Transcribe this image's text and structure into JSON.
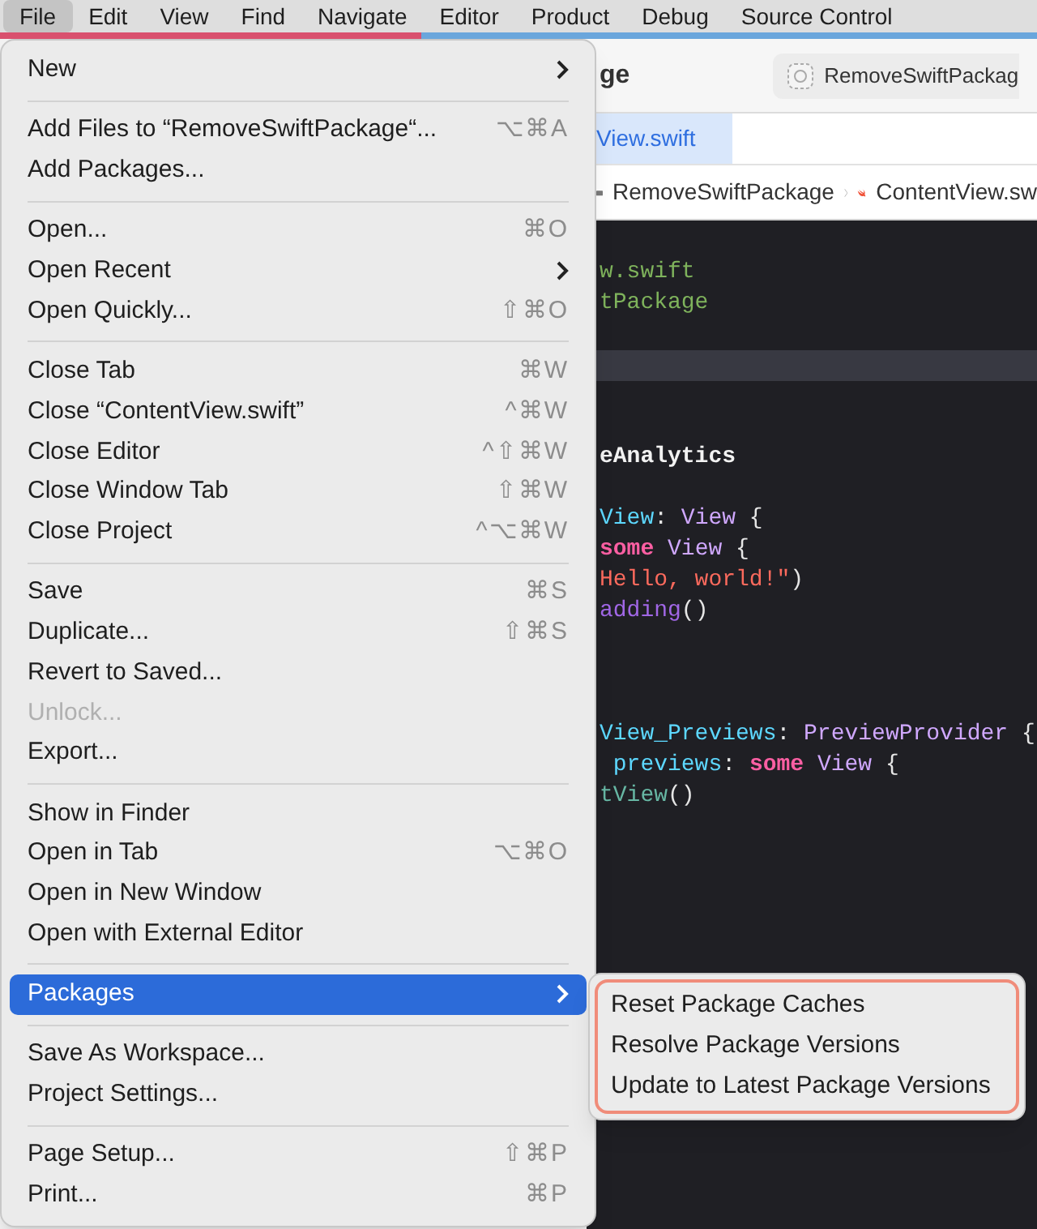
{
  "menu_bar": [
    {
      "label": "File",
      "selected": true
    },
    {
      "label": "Edit",
      "selected": false
    },
    {
      "label": "View",
      "selected": false
    },
    {
      "label": "Find",
      "selected": false
    },
    {
      "label": "Navigate",
      "selected": false
    },
    {
      "label": "Editor",
      "selected": false
    },
    {
      "label": "Product",
      "selected": false
    },
    {
      "label": "Debug",
      "selected": false
    },
    {
      "label": "Source Control",
      "selected": false
    }
  ],
  "toolbar": {
    "title": "ge",
    "scheme": "RemoveSwiftPackag"
  },
  "tabs": [
    {
      "label": "View.swift",
      "selected": true
    }
  ],
  "jump_bar": [
    "RemoveSwiftPackage",
    "ContentView.sw"
  ],
  "code_lines": [
    {
      "current": false
    },
    {
      "current": false,
      "tokens": [
        {
          "text": "w.swift",
          "kind": "comment"
        }
      ]
    },
    {
      "current": false,
      "tokens": [
        {
          "text": "tPackage",
          "kind": "comment"
        }
      ]
    },
    {
      "current": false
    },
    {
      "current": true
    },
    {
      "current": false
    },
    {
      "current": false
    },
    {
      "current": false,
      "tokens": [
        {
          "text": "eAnalytics",
          "kind": "module"
        }
      ]
    },
    {
      "current": false
    },
    {
      "current": false,
      "tokens": [
        {
          "text": "View",
          "kind": "decl"
        },
        {
          "text": ": ",
          "kind": "plain"
        },
        {
          "text": "View",
          "kind": "type"
        },
        {
          "text": " {",
          "kind": "plain"
        }
      ]
    },
    {
      "current": false,
      "tokens": [
        {
          "text": "some",
          "kind": "keyword"
        },
        {
          "text": " View",
          "kind": "type"
        },
        {
          "text": " {",
          "kind": "plain"
        }
      ]
    },
    {
      "current": false,
      "tokens": [
        {
          "text": "Hello, world!\"",
          "kind": "string"
        },
        {
          "text": ")",
          "kind": "plain"
        }
      ]
    },
    {
      "current": false,
      "tokens": [
        {
          "text": "adding",
          "kind": "method"
        },
        {
          "text": "()",
          "kind": "plain"
        }
      ]
    },
    {
      "current": false
    },
    {
      "current": false
    },
    {
      "current": false
    },
    {
      "current": false,
      "tokens": [
        {
          "text": "View_Previews",
          "kind": "decl"
        },
        {
          "text": ": ",
          "kind": "plain"
        },
        {
          "text": "PreviewProvider",
          "kind": "type"
        },
        {
          "text": " {",
          "kind": "plain"
        }
      ]
    },
    {
      "current": false,
      "tokens": [
        {
          "text": " previews",
          "kind": "decl"
        },
        {
          "text": ": ",
          "kind": "plain"
        },
        {
          "text": "some",
          "kind": "keyword"
        },
        {
          "text": " View",
          "kind": "type"
        },
        {
          "text": " {",
          "kind": "plain"
        }
      ]
    },
    {
      "current": false,
      "tokens": [
        {
          "text": "tView",
          "kind": "call"
        },
        {
          "text": "()",
          "kind": "plain"
        }
      ]
    }
  ],
  "file_menu": [
    {
      "kind": "item",
      "label": "New",
      "submenu": true,
      "selected": false,
      "disabled": false
    },
    {
      "kind": "separator"
    },
    {
      "kind": "item",
      "label": "Add Files to “RemoveSwiftPackage“...",
      "shortcut": "⌥⌘A",
      "selected": false,
      "disabled": false
    },
    {
      "kind": "item",
      "label": "Add Packages...",
      "selected": false,
      "disabled": false
    },
    {
      "kind": "separator"
    },
    {
      "kind": "item",
      "label": "Open...",
      "shortcut": "⌘O",
      "selected": false,
      "disabled": false
    },
    {
      "kind": "item",
      "label": "Open Recent",
      "submenu": true,
      "selected": false,
      "disabled": false
    },
    {
      "kind": "item",
      "label": "Open Quickly...",
      "shortcut": "⇧⌘O",
      "selected": false,
      "disabled": false
    },
    {
      "kind": "separator"
    },
    {
      "kind": "item",
      "label": "Close Tab",
      "shortcut": "⌘W",
      "selected": false,
      "disabled": false
    },
    {
      "kind": "item",
      "label": "Close “ContentView.swift”",
      "shortcut": "^⌘W",
      "selected": false,
      "disabled": false
    },
    {
      "kind": "item",
      "label": "Close Editor",
      "shortcut": "^⇧⌘W",
      "selected": false,
      "disabled": false
    },
    {
      "kind": "item",
      "label": "Close Window Tab",
      "shortcut": "⇧⌘W",
      "selected": false,
      "disabled": false
    },
    {
      "kind": "item",
      "label": "Close Project",
      "shortcut": "^⌥⌘W",
      "selected": false,
      "disabled": false
    },
    {
      "kind": "separator"
    },
    {
      "kind": "item",
      "label": "Save",
      "shortcut": "⌘S",
      "selected": false,
      "disabled": false
    },
    {
      "kind": "item",
      "label": "Duplicate...",
      "shortcut": "⇧⌘S",
      "selected": false,
      "disabled": false
    },
    {
      "kind": "item",
      "label": "Revert to Saved...",
      "selected": false,
      "disabled": false
    },
    {
      "kind": "item",
      "label": "Unlock...",
      "selected": false,
      "disabled": true
    },
    {
      "kind": "item",
      "label": "Export...",
      "selected": false,
      "disabled": false
    },
    {
      "kind": "separator"
    },
    {
      "kind": "item",
      "label": "Show in Finder",
      "selected": false,
      "disabled": false
    },
    {
      "kind": "item",
      "label": "Open in Tab",
      "shortcut": "⌥⌘O",
      "selected": false,
      "disabled": false
    },
    {
      "kind": "item",
      "label": "Open in New Window",
      "selected": false,
      "disabled": false
    },
    {
      "kind": "item",
      "label": "Open with External Editor",
      "selected": false,
      "disabled": false
    },
    {
      "kind": "separator"
    },
    {
      "kind": "item",
      "label": "Packages",
      "submenu": true,
      "selected": true,
      "disabled": false
    },
    {
      "kind": "separator"
    },
    {
      "kind": "item",
      "label": "Save As Workspace...",
      "selected": false,
      "disabled": false
    },
    {
      "kind": "item",
      "label": "Project Settings...",
      "selected": false,
      "disabled": false
    },
    {
      "kind": "separator"
    },
    {
      "kind": "item",
      "label": "Page Setup...",
      "shortcut": "⇧⌘P",
      "selected": false,
      "disabled": false
    },
    {
      "kind": "item",
      "label": "Print...",
      "shortcut": "⌘P",
      "selected": false,
      "disabled": false
    }
  ],
  "packages_submenu": {
    "highlighted": true,
    "items": [
      "Reset Package Caches",
      "Resolve Package Versions",
      "Update to Latest Package Versions"
    ]
  }
}
